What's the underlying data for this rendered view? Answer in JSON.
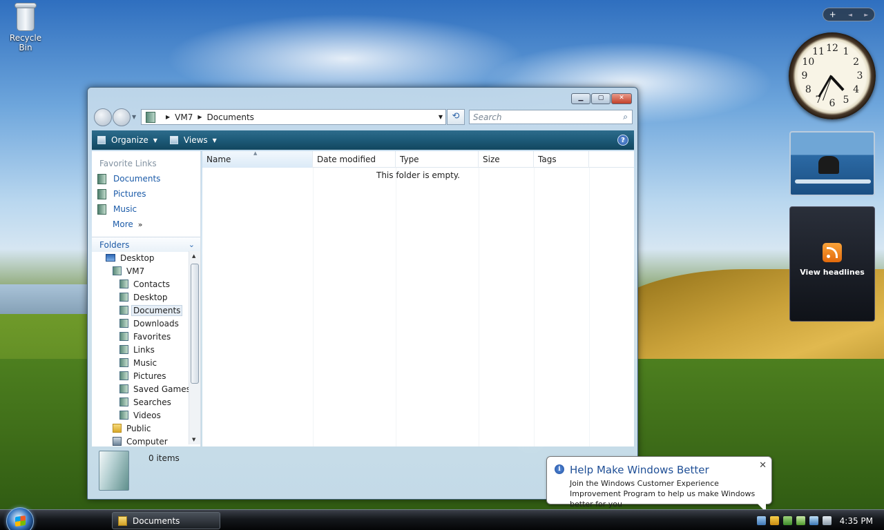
{
  "desktop": {
    "recycle_bin_label": "Recycle Bin"
  },
  "gadgets": {
    "controls": {
      "add": "+",
      "prev": "◄",
      "next": "►"
    },
    "clock_numbers": [
      "12",
      "1",
      "2",
      "3",
      "4",
      "5",
      "6",
      "7",
      "8",
      "9",
      "10",
      "11"
    ],
    "feed_label": "View headlines"
  },
  "window": {
    "buttons": {
      "minimize": "▁",
      "maximize": "▢",
      "close": "✕"
    },
    "address": {
      "segments": [
        "VM7",
        "Documents"
      ]
    },
    "search": {
      "placeholder": "Search"
    },
    "commands": {
      "organize": "Organize",
      "views": "Views",
      "help": "?"
    },
    "favorites": {
      "header": "Favorite Links",
      "items": [
        "Documents",
        "Pictures",
        "Music"
      ],
      "more": "More",
      "more_glyph": "»"
    },
    "folders": {
      "header": "Folders",
      "tree": [
        {
          "label": "Desktop",
          "icon": "desktop-icon"
        },
        {
          "label": "VM7",
          "icon": "user-folder-icon"
        },
        {
          "label": "Contacts",
          "icon": "contacts-folder-icon"
        },
        {
          "label": "Desktop",
          "icon": "desktop-folder-icon"
        },
        {
          "label": "Documents",
          "icon": "documents-folder-icon",
          "selected": true
        },
        {
          "label": "Downloads",
          "icon": "downloads-folder-icon"
        },
        {
          "label": "Favorites",
          "icon": "favorites-folder-icon"
        },
        {
          "label": "Links",
          "icon": "links-folder-icon"
        },
        {
          "label": "Music",
          "icon": "music-folder-icon"
        },
        {
          "label": "Pictures",
          "icon": "pictures-folder-icon"
        },
        {
          "label": "Saved Games",
          "icon": "saved-games-folder-icon"
        },
        {
          "label": "Searches",
          "icon": "searches-folder-icon"
        },
        {
          "label": "Videos",
          "icon": "videos-folder-icon"
        },
        {
          "label": "Public",
          "icon": "public-folder-icon"
        },
        {
          "label": "Computer",
          "icon": "computer-icon"
        }
      ]
    },
    "columns": [
      "Name",
      "Date modified",
      "Type",
      "Size",
      "Tags"
    ],
    "empty_message": "This folder is empty.",
    "details": {
      "item_count": "0 items"
    }
  },
  "notification": {
    "title": "Help Make Windows Better",
    "message": "Join the Windows Customer Experience Improvement Program to help us make Windows better for you",
    "close": "✕"
  },
  "taskbar": {
    "open_window": "Documents",
    "clock": "4:35 PM"
  }
}
